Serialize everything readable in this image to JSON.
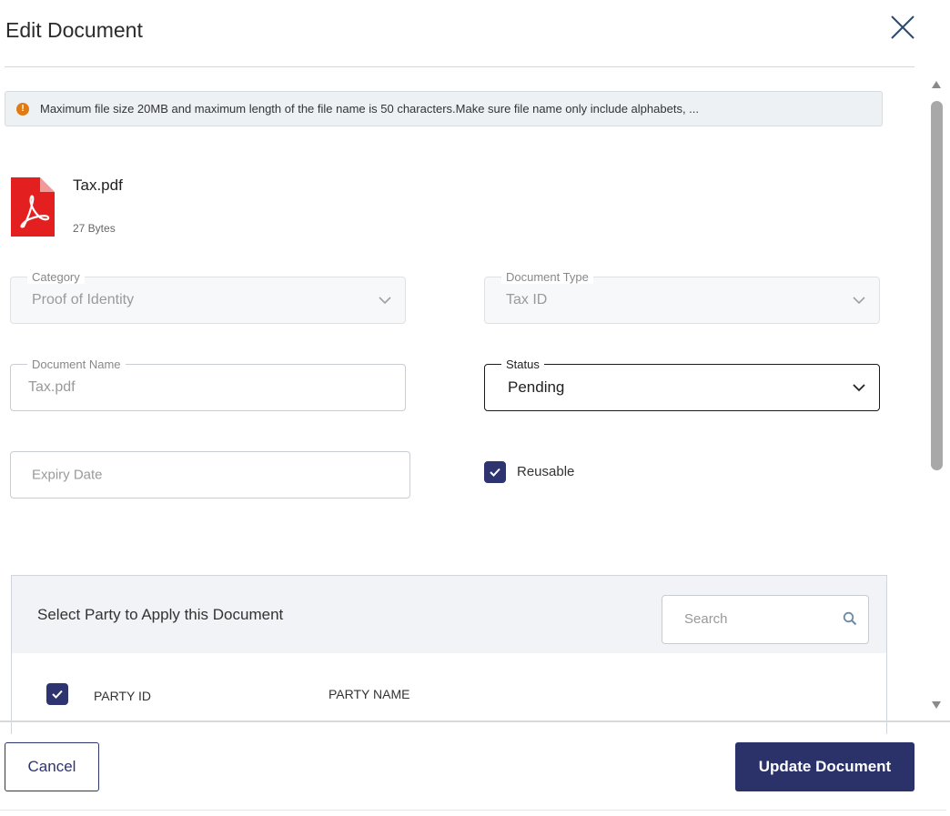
{
  "dialog": {
    "title": "Edit Document"
  },
  "notice": {
    "text": "Maximum file size 20MB and maximum length of the file name is 50 characters.Make sure file name only include alphabets, ..."
  },
  "file": {
    "name": "Tax.pdf",
    "size": "27 Bytes",
    "icon": "pdf-file-icon"
  },
  "fields": {
    "category": {
      "label": "Category",
      "value": "Proof of Identity"
    },
    "document_type": {
      "label": "Document Type",
      "value": "Tax ID"
    },
    "document_name": {
      "label": "Document Name",
      "value": "Tax.pdf"
    },
    "status": {
      "label": "Status",
      "value": "Pending"
    },
    "expiry_date": {
      "placeholder": "Expiry Date"
    },
    "reusable": {
      "label": "Reusable",
      "checked": true
    }
  },
  "party": {
    "title": "Select Party to Apply this Document",
    "search_placeholder": "Search",
    "columns": {
      "id": "PARTY ID",
      "name": "PARTY NAME"
    }
  },
  "footer": {
    "cancel_label": "Cancel",
    "update_label": "Update Document"
  },
  "colors": {
    "primary": "#2b3169",
    "notice_icon": "#e07b12",
    "pdf_red": "#e3201f"
  }
}
